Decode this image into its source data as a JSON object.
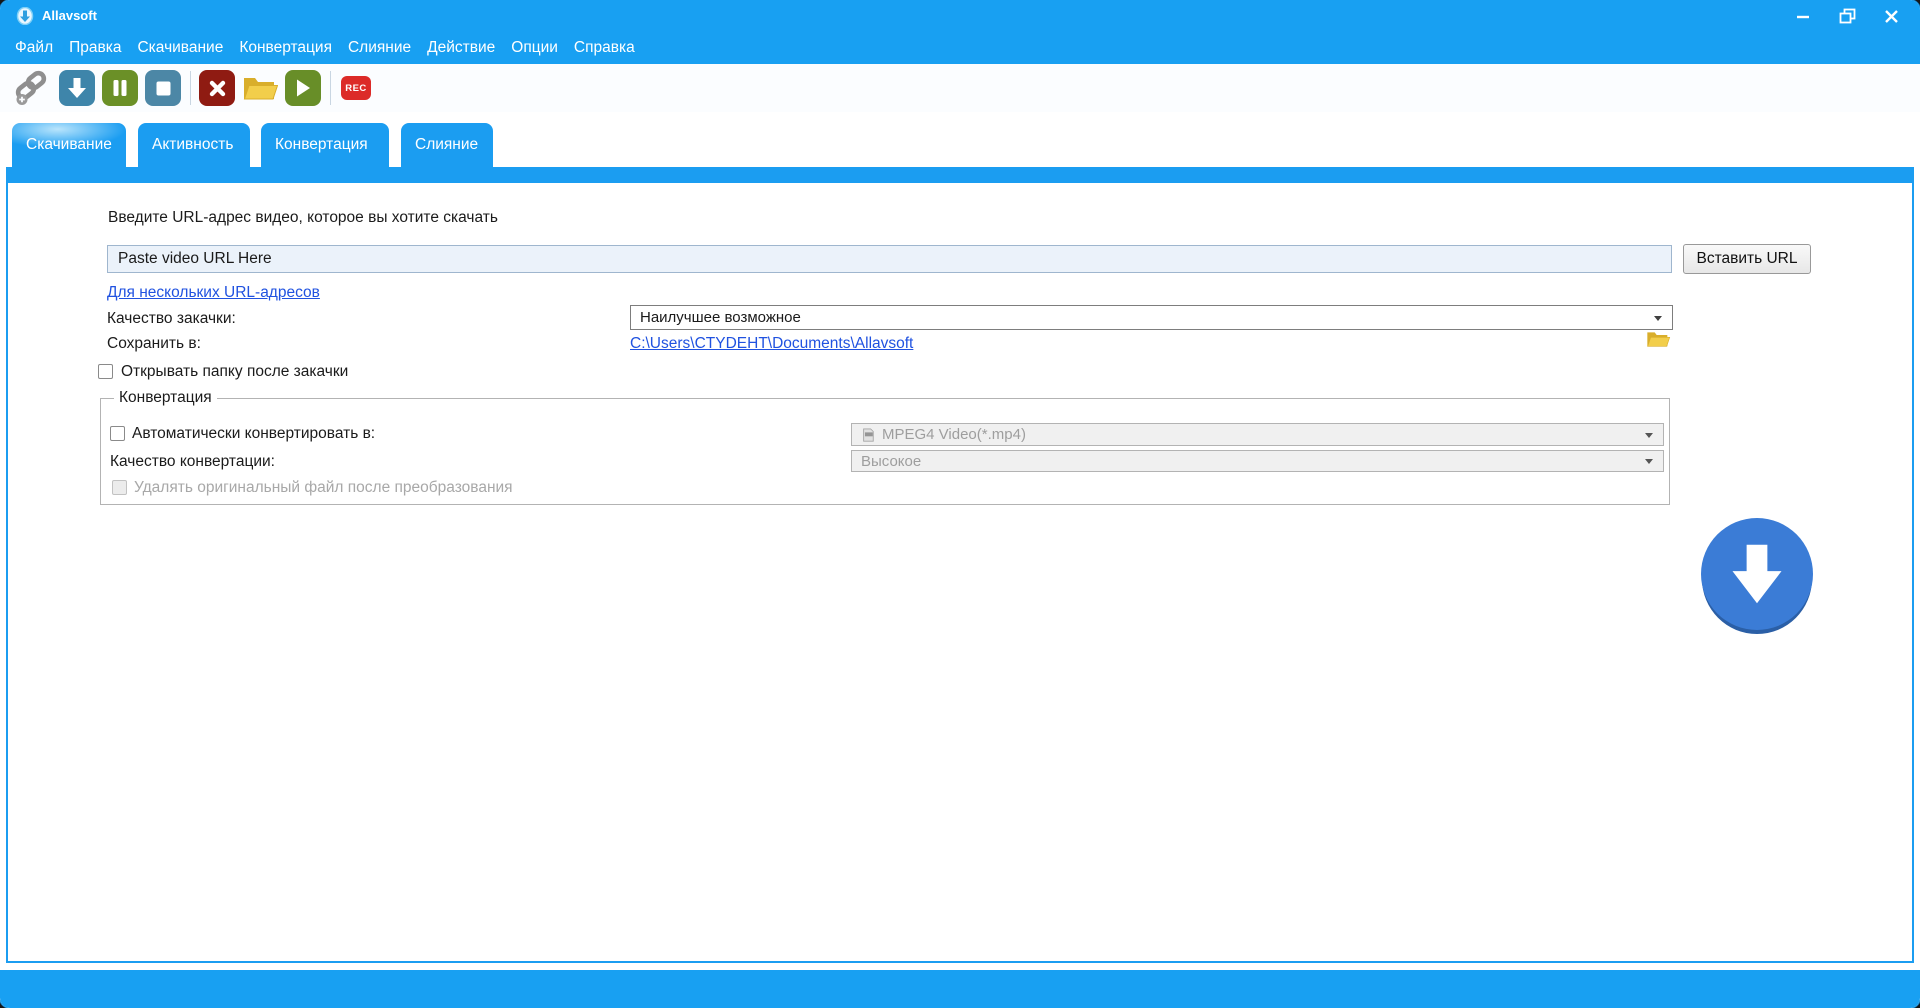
{
  "window": {
    "title": "Allavsoft",
    "controls": {
      "minimize": "minimize",
      "restore": "restore",
      "close": "close"
    }
  },
  "colors": {
    "accent_blue": "#18A0F2",
    "link_blue": "#2052E0",
    "download_circle": "#3B7CD6",
    "toolbar_teal": "#3E85AA",
    "toolbar_olive": "#6B9027",
    "toolbar_dark_red": "#8F1B12",
    "toolbar_red": "#DC2B28",
    "folder_gold": "#F2CE4B"
  },
  "menu": {
    "items": [
      "Файл",
      "Правка",
      "Скачивание",
      "Конвертация",
      "Слияние",
      "Действие",
      "Опции",
      "Справка"
    ]
  },
  "toolbar": {
    "record_label": "REC"
  },
  "tabs": [
    {
      "label": "Скачивание",
      "active": true
    },
    {
      "label": "Активность",
      "active": false
    },
    {
      "label": "Конвертация",
      "active": false
    },
    {
      "label": "Слияние",
      "active": false
    }
  ],
  "download_tab": {
    "url_label": "Введите URL-адрес видео, которое вы хотите скачать",
    "url_value": "Paste video URL Here",
    "paste_button": "Вставить URL",
    "multi_url_link": "Для нескольких URL-адресов",
    "quality_label": "Качество закачки:",
    "quality_value": "Наилучшее возможное",
    "save_label": "Сохранить в:",
    "save_path": "C:\\Users\\CTYDEHT\\Documents\\Allavsoft",
    "open_folder_checkbox": "Открывать папку после закачки",
    "conversion_group": {
      "legend": "Конвертация",
      "auto_convert_checkbox": "Автоматически конвертировать в:",
      "format_value": "MPEG4 Video(*.mp4)",
      "quality_label": "Качество конвертации:",
      "quality_value": "Высокое",
      "delete_original_checkbox": "Удалять оригинальный файл после преобразования"
    }
  }
}
